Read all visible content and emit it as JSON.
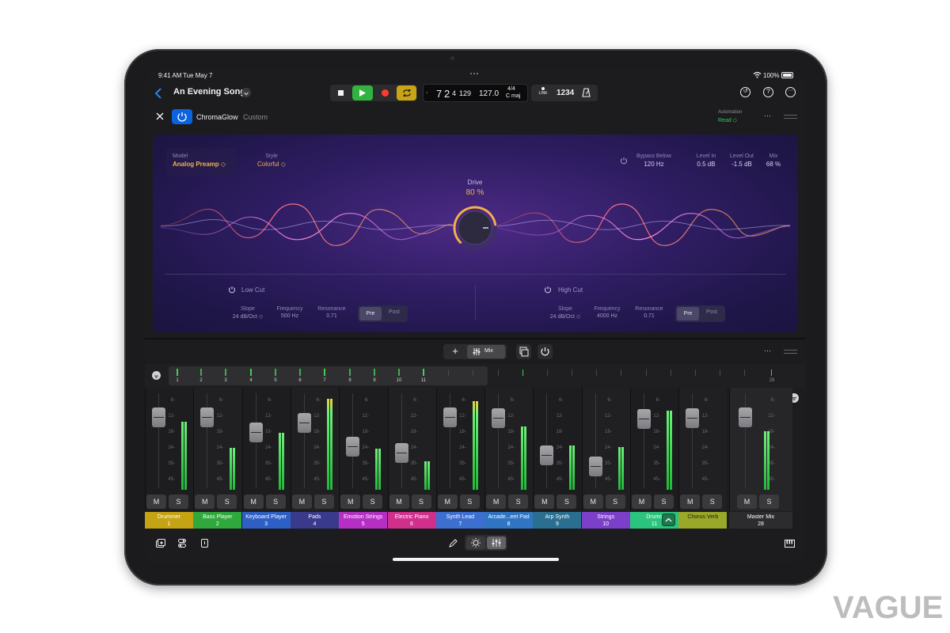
{
  "status_bar": {
    "time": "9:41 AM",
    "date": "Tue May 7",
    "battery": "100%"
  },
  "header": {
    "song_title": "An Evening Song"
  },
  "lcd": {
    "bar": "7",
    "beat": "2",
    "sub": "4",
    "ticks": "129",
    "tempo": "127.0",
    "signature": "4/4",
    "key": "C maj"
  },
  "toolbar": {
    "link_label": "LINK",
    "count_in": "1234"
  },
  "plugin": {
    "name": "ChromaGlow",
    "preset": "Custom",
    "automation_label": "Automation",
    "automation_value": "Read ◇",
    "model_label": "Model",
    "model_value": "Analog Preamp ◇",
    "style_label": "Style",
    "style_value": "Colorful ◇",
    "bypass_label": "Bypass Below",
    "bypass_value": "120 Hz",
    "level_in_label": "Level In",
    "level_in_value": "0.5 dB",
    "level_out_label": "Level Out",
    "level_out_value": "-1.5 dB",
    "mix_label": "Mix",
    "mix_value": "68 %",
    "drive_label": "Drive",
    "drive_value": "80 %",
    "drive_level": 0.8,
    "low_cut": {
      "title": "Low Cut",
      "slope_label": "Slope",
      "slope_value": "24 dB/Oct ◇",
      "freq_label": "Frequency",
      "freq_value": "500 Hz",
      "res_label": "Resonance",
      "res_value": "0.71",
      "pre": "Pre",
      "post": "Post"
    },
    "high_cut": {
      "title": "High Cut",
      "slope_label": "Slope",
      "slope_value": "24 dB/Oct ◇",
      "freq_label": "Frequency",
      "freq_value": "4000 Hz",
      "res_label": "Resonance",
      "res_value": "0.71",
      "pre": "Pre",
      "post": "Post"
    }
  },
  "mixer": {
    "mix_label": "Mix",
    "ruler_numbers": [
      "1",
      "2",
      "3",
      "4",
      "5",
      "6",
      "7",
      "8",
      "9",
      "10",
      "11"
    ],
    "ruler_last": "28",
    "scale": [
      "6-",
      "12-",
      "18-",
      "24-",
      "35-",
      "45-"
    ],
    "mute_label": "M",
    "solo_label": "S",
    "tracks": [
      {
        "name": "Drummer",
        "number": "1",
        "color": "#c5a313",
        "level": 0.72
      },
      {
        "name": "Bass Player",
        "number": "2",
        "color": "#2fa83c",
        "level": 0.44
      },
      {
        "name": "Keyboard Player",
        "number": "3",
        "color": "#2e5fc4",
        "level": 0.6
      },
      {
        "name": "Pads",
        "number": "4",
        "color": "#3a3a8c",
        "level": 0.96
      },
      {
        "name": "Emotion Strings",
        "number": "5",
        "color": "#b52fc4",
        "level": 0.43
      },
      {
        "name": "Electric Piano",
        "number": "6",
        "color": "#d02f8c",
        "level": 0.3
      },
      {
        "name": "Synth Lead",
        "number": "7",
        "color": "#3d6fd1",
        "level": 0.93
      },
      {
        "name": "Arcade...eet Pad",
        "number": "8",
        "color": "#2f75c4",
        "level": 0.67
      },
      {
        "name": "Arp Synth",
        "number": "9",
        "color": "#2a6f8f",
        "level": 0.47
      },
      {
        "name": "Strings",
        "number": "10",
        "color": "#7b3fc9",
        "level": 0.45
      },
      {
        "name": "Drums",
        "number": "11",
        "color": "#2bc47d",
        "level": 0.83
      },
      {
        "name": "Chorus Verb",
        "number": "",
        "color": "#9aa82a",
        "level": 0.0
      },
      {
        "name": "Master Mix",
        "number": "28",
        "color": "#2c2c2e",
        "level": 0.62
      }
    ]
  },
  "watermark": "VAGUE"
}
